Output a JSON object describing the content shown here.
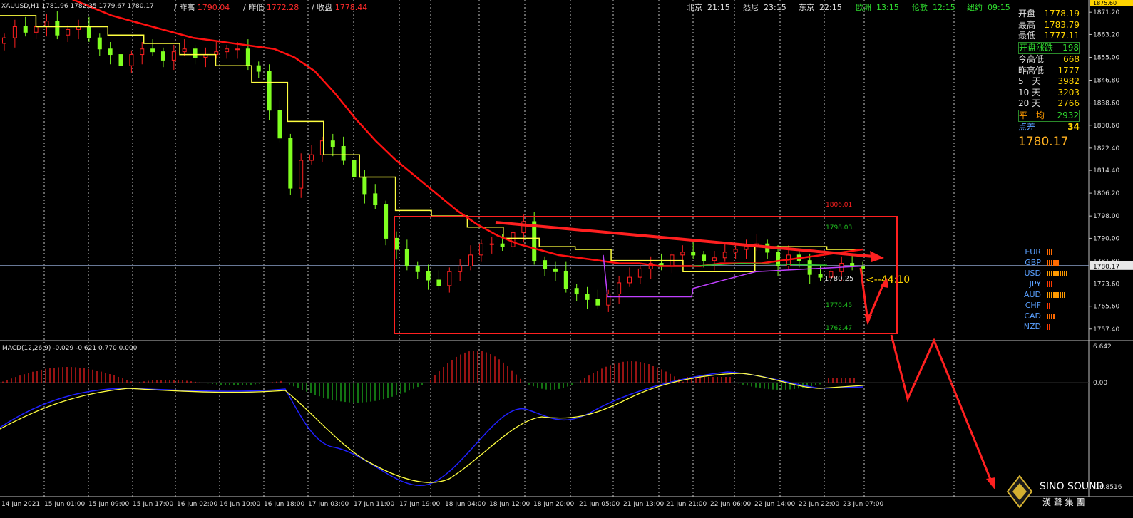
{
  "header": {
    "symbol": "XAUUSD,H1",
    "ohlc": "1781.96 1782.35 1779.67 1780.17",
    "prev_high_label": "/ 昨高",
    "prev_high": "1790.04",
    "prev_low_label": "/ 昨低",
    "prev_low": "1772.28",
    "close_label": "/ 收盘",
    "close": "1778.44",
    "sessions": [
      {
        "city": "北京",
        "time": "21:15"
      },
      {
        "city": "悉尼",
        "time": "23:15"
      },
      {
        "city": "东京",
        "time": "22:15"
      },
      {
        "city": "欧洲",
        "time": "13:15"
      },
      {
        "city": "伦敦",
        "time": "12:15"
      },
      {
        "city": "纽约",
        "time": "09:15"
      }
    ]
  },
  "info_panel": {
    "rows": [
      {
        "label": "开盘",
        "value": "1778.19"
      },
      {
        "label": "最高",
        "value": "1783.79"
      },
      {
        "label": "最低",
        "value": "1777.11"
      },
      {
        "label": "开盘涨跌",
        "value": "198"
      },
      {
        "label": "今高低",
        "value": "668"
      },
      {
        "label": "昨高低",
        "value": "1777"
      },
      {
        "label": "5　天",
        "value": "3982"
      },
      {
        "label": "10 天",
        "value": "3203"
      },
      {
        "label": "20 天",
        "value": "2766"
      },
      {
        "label": "平　均",
        "value": "2932"
      },
      {
        "label": "点差",
        "value": "34"
      }
    ],
    "last_price": "1780.17"
  },
  "currency_strength": [
    {
      "currency": "EUR",
      "bars": 3,
      "color": "#ff6a00"
    },
    {
      "currency": "GBP",
      "bars": 6,
      "color": "#ff6a00"
    },
    {
      "currency": "USD",
      "bars": 10,
      "color": "#ff9a00"
    },
    {
      "currency": "JPY",
      "bars": 3,
      "color": "#ff3a00"
    },
    {
      "currency": "AUD",
      "bars": 9,
      "color": "#ff9a00"
    },
    {
      "currency": "CHF",
      "bars": 2,
      "color": "#ff3a00"
    },
    {
      "currency": "CAD",
      "bars": 4,
      "color": "#ff6a00"
    },
    {
      "currency": "NZD",
      "bars": 2,
      "color": "#ff3a00"
    }
  ],
  "annotations": {
    "level_high": "1806.01",
    "level_upper": "1798.03",
    "level_mid": "1780.25",
    "level_lower": "1770.45",
    "level_low": "1762.47",
    "countdown": "<--44:10"
  },
  "chart_data": {
    "type": "candlestick",
    "symbol": "XAUUSD",
    "timeframe": "H1",
    "price_axis_ticks": [
      "1871.20",
      "1863.20",
      "1855.00",
      "1846.80",
      "1838.60",
      "1830.60",
      "1822.40",
      "1814.40",
      "1806.20",
      "1798.00",
      "1790.00",
      "1781.80",
      "1773.60",
      "1765.60",
      "1757.40"
    ],
    "current_price": "1780.17",
    "top_right_price": "1875.60",
    "time_axis_labels": [
      "14 Jun 2021",
      "15 Jun 01:00",
      "15 Jun 09:00",
      "15 Jun 17:00",
      "16 Jun 02:00",
      "16 Jun 10:00",
      "16 Jun 18:00",
      "17 Jun 03:00",
      "17 Jun 11:00",
      "17 Jun 19:00",
      "18 Jun 04:00",
      "18 Jun 12:00",
      "18 Jun 20:00",
      "21 Jun 05:00",
      "21 Jun 13:00",
      "21 Jun 21:00",
      "22 Jun 06:00",
      "22 Jun 14:00",
      "22 Jun 22:00",
      "23 Jun 07:00"
    ],
    "close_path": [
      1862,
      1866,
      1864,
      1866,
      1868,
      1863,
      1865,
      1866,
      1862,
      1858,
      1856,
      1852,
      1856,
      1858,
      1857,
      1854,
      1857,
      1858,
      1855,
      1856,
      1857,
      1858,
      1858,
      1852,
      1850,
      1836,
      1826,
      1808,
      1818,
      1820,
      1825,
      1823,
      1818,
      1812,
      1806,
      1802,
      1790,
      1786,
      1780,
      1778,
      1775,
      1773,
      1778,
      1780,
      1784,
      1788,
      1788,
      1787,
      1792,
      1796,
      1782,
      1779,
      1778,
      1772,
      1770,
      1768,
      1766,
      1770,
      1774,
      1776,
      1779,
      1781,
      1780,
      1784,
      1785,
      1784,
      1782,
      1783,
      1785,
      1786,
      1787,
      1788,
      1785,
      1780,
      1784,
      1782,
      1777,
      1776,
      1778,
      1781,
      1780,
      1779
    ],
    "ma_red": [
      1876,
      1873,
      1870,
      1868,
      1866,
      1864,
      1862,
      1861,
      1860,
      1859,
      1858,
      1855,
      1850,
      1842,
      1833,
      1825,
      1818,
      1812,
      1806,
      1800,
      1795,
      1791,
      1788,
      1786,
      1784,
      1783,
      1782,
      1781,
      1781,
      1780,
      1780,
      1780,
      1781,
      1781,
      1781,
      1782,
      1783,
      1784,
      1785,
      1786
    ],
    "ma_yellow_steps": [
      1870,
      1866,
      1866,
      1863,
      1860,
      1856,
      1852,
      1846,
      1832,
      1820,
      1812,
      1800,
      1798,
      1794,
      1790,
      1787,
      1786,
      1782,
      1782,
      1778,
      1778,
      1787,
      1787,
      1786
    ],
    "macd": {
      "label": "MACD(12,26,9) -0.029 -0.621 0.770 0.000",
      "axis_ticks": [
        "6.642",
        "0.00",
        "-16.8516"
      ],
      "series": [
        {
          "name": "signal",
          "color": "#ffff00"
        },
        {
          "name": "macd",
          "color": "#2020ff"
        },
        {
          "name": "histogram",
          "colors": [
            "#ff2020",
            "#20c020"
          ]
        }
      ]
    }
  },
  "watermark": {
    "line1": "SINO SOUND",
    "line2": "漢 聲 集 團"
  }
}
